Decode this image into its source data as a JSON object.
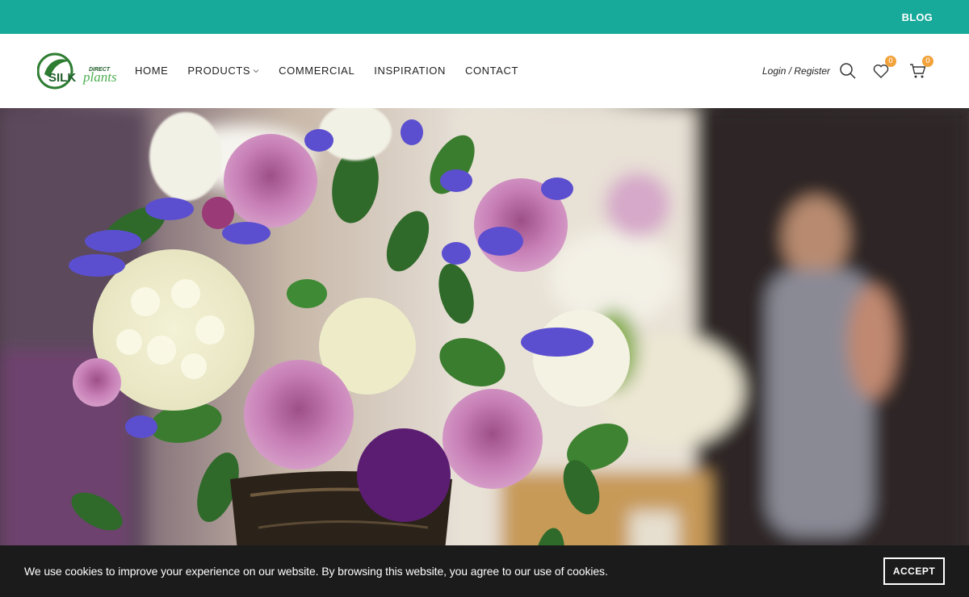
{
  "topbar": {
    "blog_label": "BLOG",
    "color": "#17a99a"
  },
  "header": {
    "logo_alt": "Silk Plants Direct",
    "nav": [
      {
        "label": "HOME"
      },
      {
        "label": "PRODUCTS"
      },
      {
        "label": "COMMERCIAL"
      },
      {
        "label": "INSPIRATION"
      },
      {
        "label": "CONTACT"
      }
    ],
    "login_label": "Login / Register",
    "wishlist_count": "0",
    "cart_count": "0",
    "badge_color": "#f2a23a"
  },
  "logo": {
    "brand_top": "DIRECT",
    "brand_silk": "SILK",
    "brand_plants": "plants"
  },
  "hero": {
    "image_subject": "flower-arrangement"
  },
  "cookie": {
    "message": "We use cookies to improve your experience on our website. By browsing this website, you agree to our use of cookies.",
    "accept_label": "ACCEPT"
  }
}
